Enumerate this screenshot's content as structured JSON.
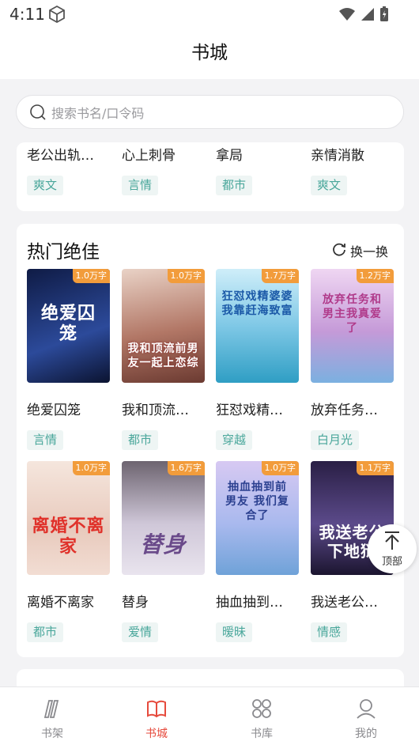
{
  "status": {
    "time": "4:11"
  },
  "header": {
    "title": "书城"
  },
  "search": {
    "placeholder": "搜索书名/口令码"
  },
  "top_card": {
    "books": [
      {
        "name": "老公出轨…",
        "tag": "爽文"
      },
      {
        "name": "心上刺骨",
        "tag": "言情"
      },
      {
        "name": "拿局",
        "tag": "都市"
      },
      {
        "name": "亲情消散",
        "tag": "爽文"
      }
    ]
  },
  "hot": {
    "title": "热门绝佳",
    "refresh_label": "换一换",
    "books": [
      {
        "name": "绝爱囚笼",
        "tag": "言情",
        "badge": "1.0万字",
        "cover_text": "绝爱囚笼",
        "cover_color": "#17255a"
      },
      {
        "name": "我和顶流…",
        "tag": "都市",
        "badge": "1.0万字",
        "cover_text": "我和顶流前男友一起上恋综",
        "cover_color": "#b77a6a"
      },
      {
        "name": "狂怼戏精…",
        "tag": "穿越",
        "badge": "1.7万字",
        "cover_text": "狂怼戏精婆婆 我靠赶海致富",
        "cover_color": "#7fc8e6"
      },
      {
        "name": "放弃任务…",
        "tag": "白月光",
        "badge": "1.2万字",
        "cover_text": "放弃任务和男主我真爱了",
        "cover_color": "#d6a8e0"
      },
      {
        "name": "离婚不离家",
        "tag": "都市",
        "badge": "1.0万字",
        "cover_text": "离婚不离家",
        "cover_color": "#efd9cf"
      },
      {
        "name": "替身",
        "tag": "爱情",
        "badge": "1.6万字",
        "cover_text": "替身",
        "cover_color": "#cfc7d8"
      },
      {
        "name": "抽血抽到…",
        "tag": "暧昧",
        "badge": "1.0万字",
        "cover_text": "抽血抽到前男友 我们复合了",
        "cover_color": "#a9b9ee"
      },
      {
        "name": "我送老公…",
        "tag": "情感",
        "badge": "1.1万字",
        "cover_text": "我送老公下地狱",
        "cover_color": "#3a2a5a"
      }
    ]
  },
  "back_to_top": {
    "label": "顶部"
  },
  "nav": [
    {
      "label": "书架",
      "icon": "bookshelf-icon"
    },
    {
      "label": "书城",
      "icon": "bookstore-icon"
    },
    {
      "label": "书库",
      "icon": "library-icon"
    },
    {
      "label": "我的",
      "icon": "profile-icon"
    }
  ],
  "colors": {
    "accent": "#e64a3c",
    "tag_text": "#4aa79b",
    "badge": "#f29c3b"
  }
}
